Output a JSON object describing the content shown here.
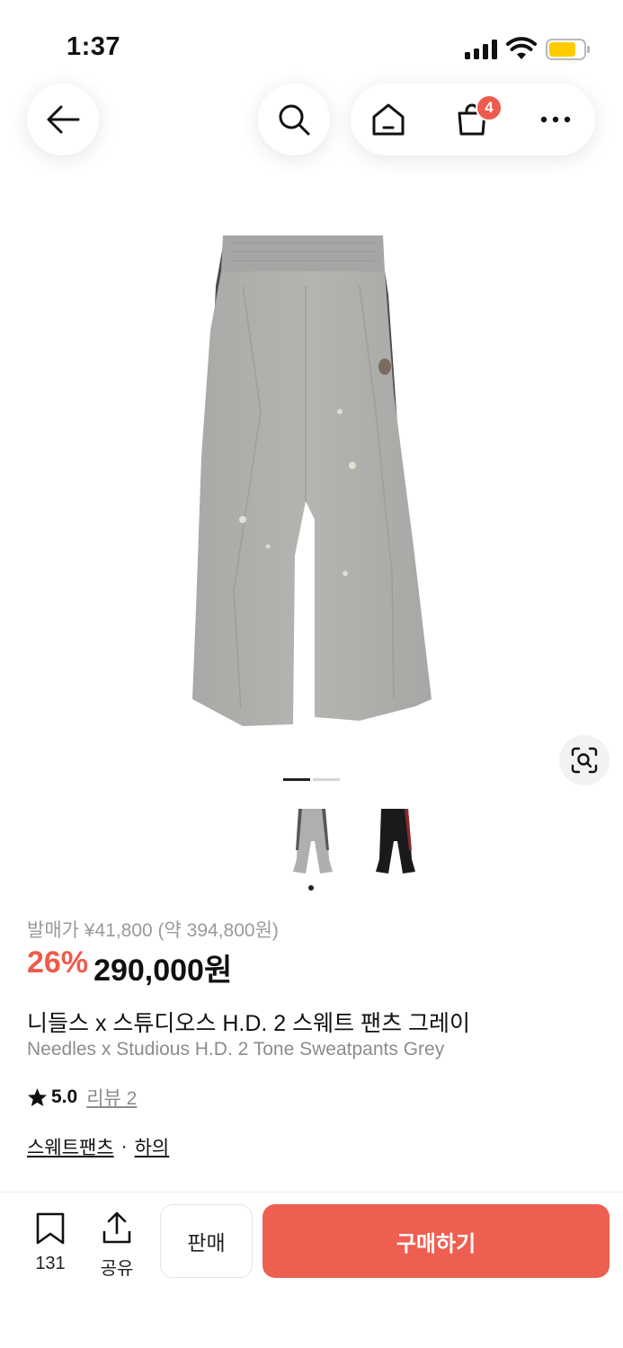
{
  "status_bar": {
    "time": "1:37"
  },
  "nav": {
    "cart_count": "4"
  },
  "gallery": {
    "current_index": 1,
    "total": 2,
    "thumbnails": [
      "grey",
      "black"
    ]
  },
  "product": {
    "original_price": "발매가 ¥41,800 (약 394,800원)",
    "discount": "26%",
    "price": "290,000원",
    "title_ko": "니들스 x 스튜디오스 H.D. 2 스웨트 팬츠 그레이",
    "title_en": "Needles x Studious H.D. 2 Tone Sweatpants Grey",
    "rating": "5.0",
    "review_label": "리뷰 2",
    "category_primary": "스웨트팬츠",
    "category_separator": "·",
    "category_secondary": "하의"
  },
  "bottom_bar": {
    "bookmark_count": "131",
    "share_label": "공유",
    "sell_label": "판매",
    "buy_label": "구매하기"
  },
  "colors": {
    "accent": "#ee5f51",
    "badge": "#ee5b4c",
    "battery": "#ffcc00"
  }
}
